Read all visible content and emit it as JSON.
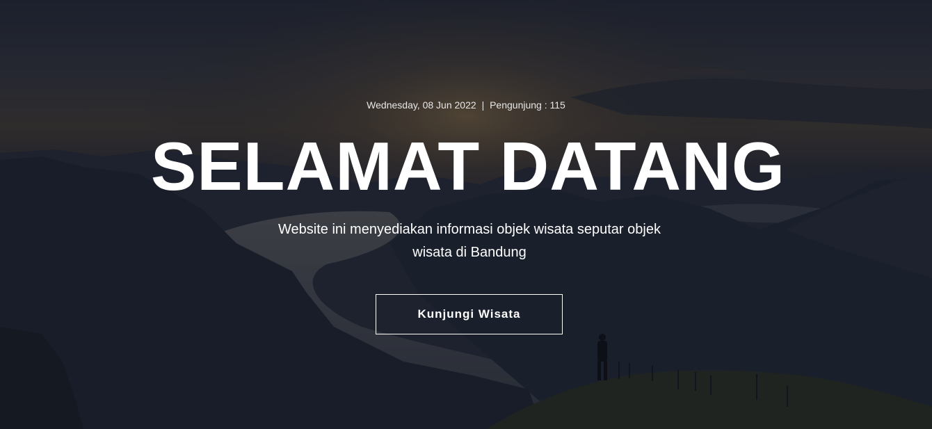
{
  "hero": {
    "date": "Wednesday, 08 Jun 2022",
    "separator": "|",
    "visitors_label": "Pengunjung : 115",
    "headline": "SELAMAT DATANG",
    "subtitle": "Website ini menyediakan informasi objek wisata seputar objek wisata di Bandung",
    "cta_label": "Kunjungi Wisata",
    "overlay_color": "#101422"
  }
}
